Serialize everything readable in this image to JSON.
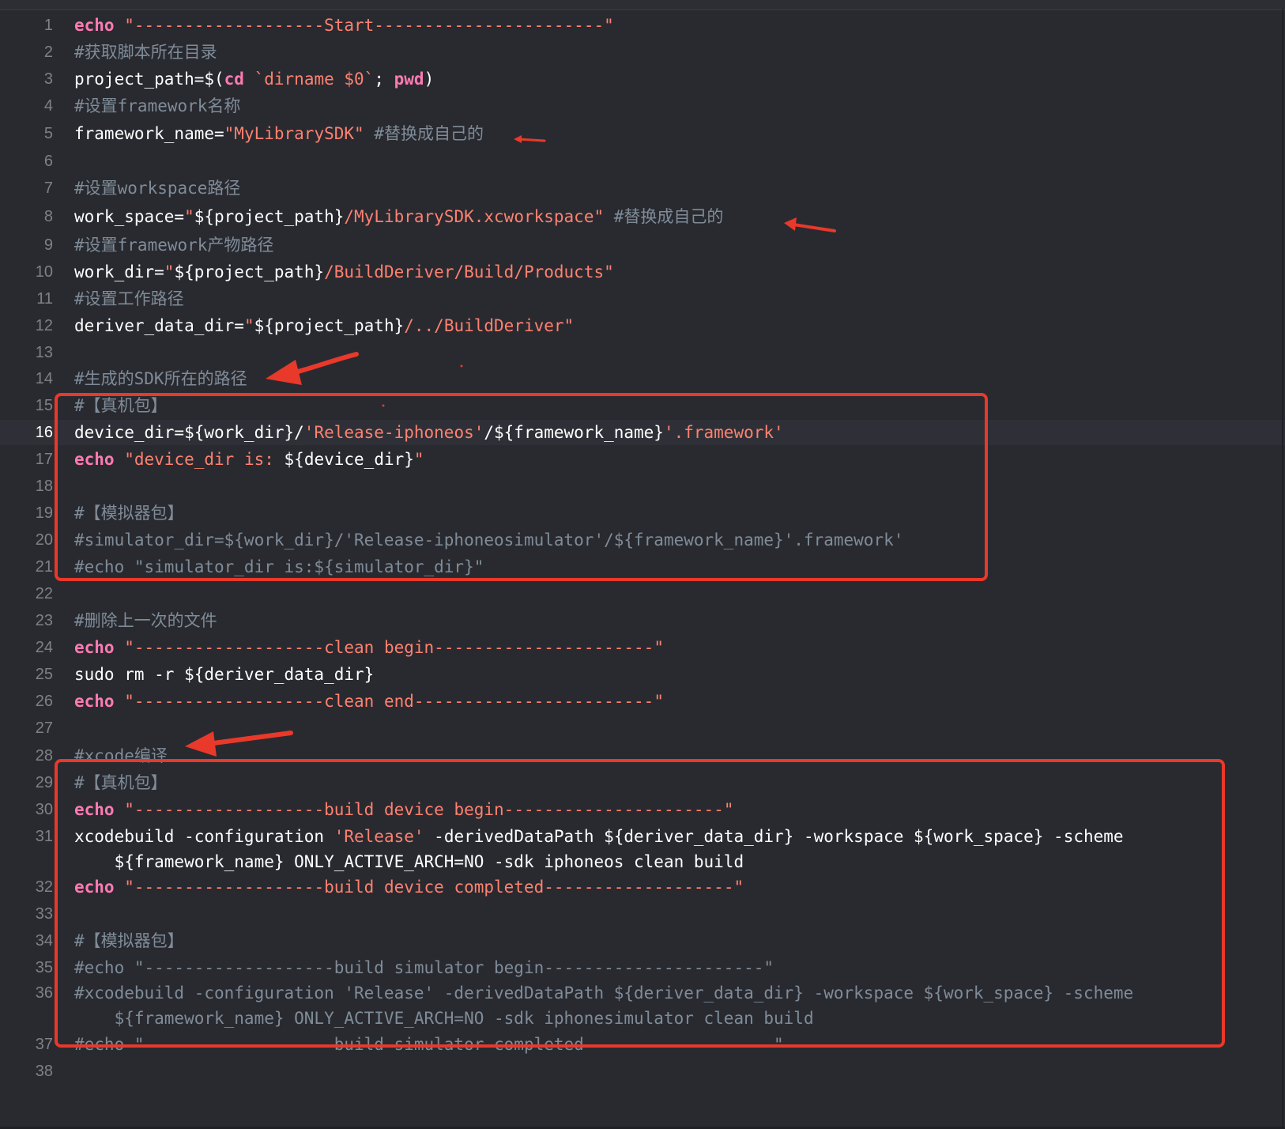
{
  "editor": {
    "current_line": 16,
    "colors": {
      "background": "#292a30",
      "keyword": "#ff7ab2",
      "string": "#ff8170",
      "comment": "#7f8c98",
      "plain": "#ffffff",
      "line_number": "#7f8088",
      "annotation": "#e8392a"
    },
    "lines": [
      {
        "num": "1",
        "tokens": [
          {
            "t": "echo",
            "c": "kw"
          },
          {
            "t": " ",
            "c": "plain"
          },
          {
            "t": "\"-------------------Start-----------------------\"",
            "c": "str"
          }
        ]
      },
      {
        "num": "2",
        "tokens": [
          {
            "t": "#获取脚本所在目录",
            "c": "cmt"
          }
        ]
      },
      {
        "num": "3",
        "tokens": [
          {
            "t": "project_path=$(",
            "c": "plain"
          },
          {
            "t": "cd",
            "c": "kw"
          },
          {
            "t": " ",
            "c": "plain"
          },
          {
            "t": "`dirname $0`",
            "c": "str"
          },
          {
            "t": "; ",
            "c": "plain"
          },
          {
            "t": "pwd",
            "c": "kw"
          },
          {
            "t": ")",
            "c": "plain"
          }
        ]
      },
      {
        "num": "4",
        "tokens": [
          {
            "t": "#设置framework名称",
            "c": "cmt"
          }
        ]
      },
      {
        "num": "5",
        "tokens": [
          {
            "t": "framework_name=",
            "c": "plain"
          },
          {
            "t": "\"MyLibrarySDK\"",
            "c": "str"
          },
          {
            "t": " #替换成自己的",
            "c": "cmt"
          }
        ]
      },
      {
        "num": "6",
        "tokens": []
      },
      {
        "num": "7",
        "tokens": [
          {
            "t": "#设置workspace路径",
            "c": "cmt"
          }
        ]
      },
      {
        "num": "8",
        "tokens": [
          {
            "t": "work_space=",
            "c": "plain"
          },
          {
            "t": "\"",
            "c": "str"
          },
          {
            "t": "${project_path}",
            "c": "plain"
          },
          {
            "t": "/MyLibrarySDK.xcworkspace\"",
            "c": "str"
          },
          {
            "t": " #替换成自己的",
            "c": "cmt"
          }
        ]
      },
      {
        "num": "9",
        "tokens": [
          {
            "t": "#设置framework产物路径",
            "c": "cmt"
          }
        ]
      },
      {
        "num": "10",
        "tokens": [
          {
            "t": "work_dir=",
            "c": "plain"
          },
          {
            "t": "\"",
            "c": "str"
          },
          {
            "t": "${project_path}",
            "c": "plain"
          },
          {
            "t": "/BuildDeriver/Build/Products\"",
            "c": "str"
          }
        ]
      },
      {
        "num": "11",
        "tokens": [
          {
            "t": "#设置工作路径",
            "c": "cmt"
          }
        ]
      },
      {
        "num": "12",
        "tokens": [
          {
            "t": "deriver_data_dir=",
            "c": "plain"
          },
          {
            "t": "\"",
            "c": "str"
          },
          {
            "t": "${project_path}",
            "c": "plain"
          },
          {
            "t": "/../BuildDeriver\"",
            "c": "str"
          }
        ]
      },
      {
        "num": "13",
        "tokens": []
      },
      {
        "num": "14",
        "tokens": [
          {
            "t": "#生成的SDK所在的路径",
            "c": "cmt"
          }
        ]
      },
      {
        "num": "15",
        "tokens": [
          {
            "t": "#【真机包】",
            "c": "cmt"
          }
        ]
      },
      {
        "num": "16",
        "tokens": [
          {
            "t": "device_dir=${work_dir}/",
            "c": "plain"
          },
          {
            "t": "'Release-iphoneos'",
            "c": "str"
          },
          {
            "t": "/${framework_name}",
            "c": "plain"
          },
          {
            "t": "'.framework'",
            "c": "str"
          }
        ]
      },
      {
        "num": "17",
        "tokens": [
          {
            "t": "echo",
            "c": "kw"
          },
          {
            "t": " ",
            "c": "plain"
          },
          {
            "t": "\"device_dir is: ",
            "c": "str"
          },
          {
            "t": "${device_dir}",
            "c": "plain"
          },
          {
            "t": "\"",
            "c": "str"
          }
        ]
      },
      {
        "num": "18",
        "tokens": []
      },
      {
        "num": "19",
        "tokens": [
          {
            "t": "#【模拟器包】",
            "c": "cmt"
          }
        ]
      },
      {
        "num": "20",
        "tokens": [
          {
            "t": "#simulator_dir=${work_dir}/'Release-iphoneosimulator'/${framework_name}'.framework'",
            "c": "cmt"
          }
        ]
      },
      {
        "num": "21",
        "tokens": [
          {
            "t": "#echo \"simulator_dir is:${simulator_dir}\"",
            "c": "cmt"
          }
        ]
      },
      {
        "num": "22",
        "tokens": []
      },
      {
        "num": "23",
        "tokens": [
          {
            "t": "#删除上一次的文件",
            "c": "cmt"
          }
        ]
      },
      {
        "num": "24",
        "tokens": [
          {
            "t": "echo",
            "c": "kw"
          },
          {
            "t": " ",
            "c": "plain"
          },
          {
            "t": "\"-------------------clean begin----------------------\"",
            "c": "str"
          }
        ]
      },
      {
        "num": "25",
        "tokens": [
          {
            "t": "sudo rm -r ${deriver_data_dir}",
            "c": "plain"
          }
        ]
      },
      {
        "num": "26",
        "tokens": [
          {
            "t": "echo",
            "c": "kw"
          },
          {
            "t": " ",
            "c": "plain"
          },
          {
            "t": "\"-------------------clean end------------------------\"",
            "c": "str"
          }
        ]
      },
      {
        "num": "27",
        "tokens": []
      },
      {
        "num": "28",
        "tokens": [
          {
            "t": "#xcode编译",
            "c": "cmt"
          }
        ]
      },
      {
        "num": "29",
        "tokens": [
          {
            "t": "#【真机包】",
            "c": "cmt"
          }
        ]
      },
      {
        "num": "30",
        "tokens": [
          {
            "t": "echo",
            "c": "kw"
          },
          {
            "t": " ",
            "c": "plain"
          },
          {
            "t": "\"-------------------build device begin----------------------\"",
            "c": "str"
          }
        ]
      },
      {
        "num": "31",
        "tokens": [
          {
            "t": "xcodebuild -configuration ",
            "c": "plain"
          },
          {
            "t": "'Release'",
            "c": "str"
          },
          {
            "t": " -derivedDataPath ${deriver_data_dir} -workspace ${work_space} -scheme",
            "c": "plain"
          }
        ]
      },
      {
        "num": "",
        "tokens": [
          {
            "t": "    ${framework_name} ONLY_ACTIVE_ARCH=NO -sdk iphoneos clean build",
            "c": "plain"
          }
        ]
      },
      {
        "num": "32",
        "tokens": [
          {
            "t": "echo",
            "c": "kw"
          },
          {
            "t": " ",
            "c": "plain"
          },
          {
            "t": "\"-------------------build device completed-------------------\"",
            "c": "str"
          }
        ]
      },
      {
        "num": "33",
        "tokens": []
      },
      {
        "num": "34",
        "tokens": [
          {
            "t": "#【模拟器包】",
            "c": "cmt"
          }
        ]
      },
      {
        "num": "35",
        "tokens": [
          {
            "t": "#echo \"-------------------build simulator begin----------------------\"",
            "c": "cmt"
          }
        ]
      },
      {
        "num": "36",
        "tokens": [
          {
            "t": "#xcodebuild -configuration 'Release' -derivedDataPath ${deriver_data_dir} -workspace ${work_space} -scheme",
            "c": "cmt"
          }
        ]
      },
      {
        "num": "",
        "tokens": [
          {
            "t": "    ${framework_name} ONLY_ACTIVE_ARCH=NO -sdk iphonesimulator clean build",
            "c": "cmt"
          }
        ]
      },
      {
        "num": "37",
        "tokens": [
          {
            "t": "#echo \"-------------------build simulator completed-------------------\"",
            "c": "cmt"
          }
        ]
      },
      {
        "num": "38",
        "tokens": []
      }
    ]
  }
}
